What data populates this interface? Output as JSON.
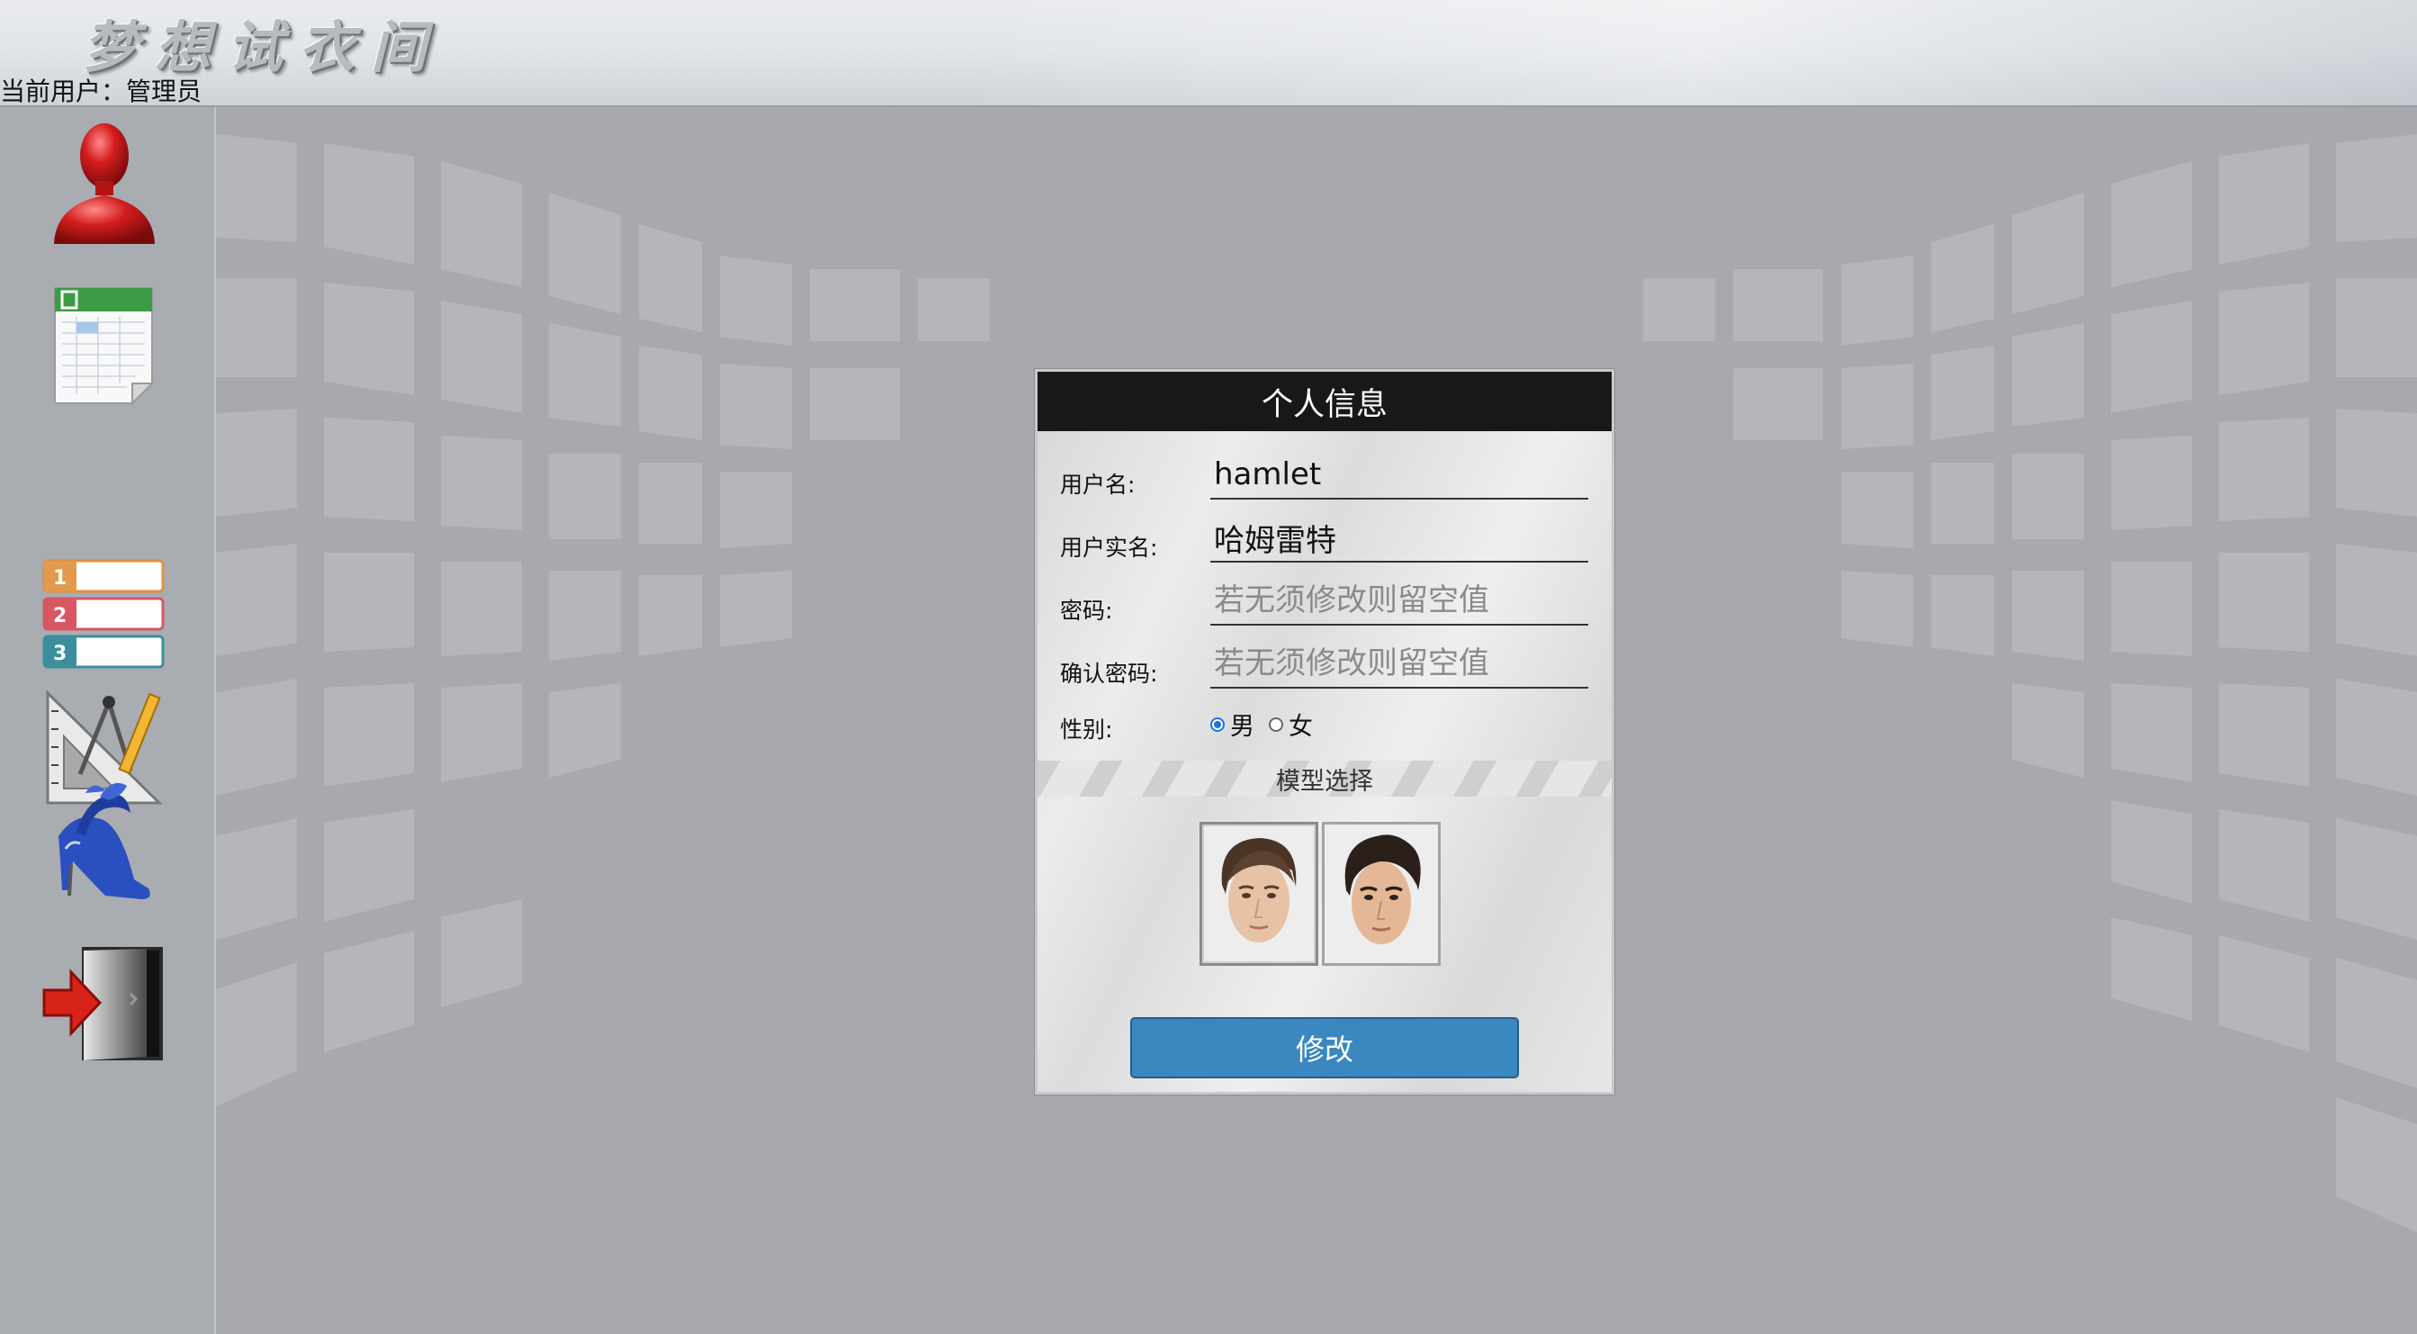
{
  "header": {
    "app_title": "梦想试衣间",
    "current_user_label": "当前用户：",
    "current_user_name": "管理员"
  },
  "sidebar": {
    "items": [
      {
        "icon": "user-profile-icon"
      },
      {
        "icon": "spreadsheet-icon"
      },
      {
        "icon": "numbered-list-icon"
      },
      {
        "icon": "design-tools-icon"
      },
      {
        "icon": "high-heel-shoes-icon"
      },
      {
        "icon": "exit-door-icon"
      }
    ]
  },
  "dialog": {
    "title": "个人信息",
    "fields": {
      "username": {
        "label": "用户名:",
        "value": "hamlet"
      },
      "realname": {
        "label": "用户实名:",
        "value": "哈姆雷特"
      },
      "password": {
        "label": "密码:",
        "placeholder": "若无须修改则留空值"
      },
      "confirm": {
        "label": "确认密码:",
        "placeholder": "若无须修改则留空值"
      }
    },
    "gender": {
      "label": "性别:",
      "options": [
        "男",
        "女"
      ],
      "selected": "男"
    },
    "model_section": "模型选择",
    "models": [
      {
        "icon": "male-model-face-1",
        "selected": true
      },
      {
        "icon": "male-model-face-2",
        "selected": false
      }
    ],
    "submit_label": "修改"
  },
  "colors": {
    "dialog_title_bg": "#17181a",
    "button_bg": "#3b87c0",
    "radio_accent": "#1a73e8",
    "backdrop": "#a7a9ad"
  }
}
